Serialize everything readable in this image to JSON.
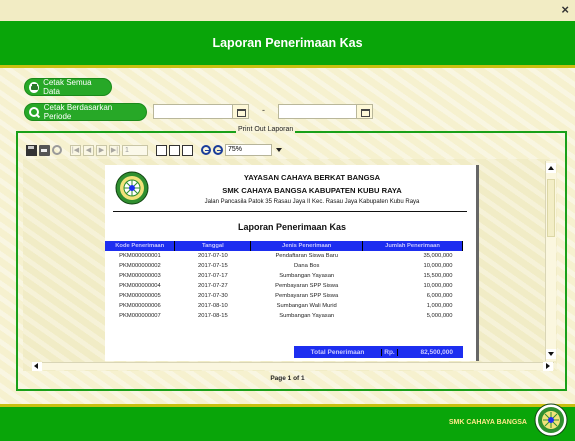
{
  "window": {
    "close_glyph": "×"
  },
  "header": {
    "title": "Laporan Penerimaan Kas"
  },
  "buttons": {
    "print_all": "Cetak Semua Data",
    "print_period": "Cetak Berdasarkan Periode"
  },
  "period": {
    "separator": "-"
  },
  "group": {
    "title": "Print Out Laporan"
  },
  "viewer_toolbar": {
    "prev": "◀",
    "first": "|◀",
    "next": "▶",
    "last": "▶|",
    "page_value": "1",
    "zoom_value": "75%"
  },
  "report": {
    "org_name": "YAYASAN CAHAYA BERKAT BANGSA",
    "school_name": "SMK CAHAYA BANGSA KABUPATEN KUBU RAYA",
    "address": "Jalan Pancasila Patok 35 Rasau Jaya II Kec. Rasau Jaya Kabupaten Kubu Raya",
    "title": "Laporan Penerimaan Kas",
    "columns": [
      "Kode Penerimaan",
      "Tanggal",
      "Jenis Penerimaan",
      "Jumlah Penerimaan"
    ],
    "rows": [
      [
        "PKM000000001",
        "2017-07-10",
        "Pendaftaran Siswa Baru",
        "35,000,000"
      ],
      [
        "PKM000000002",
        "2017-07-15",
        "Dana Bos",
        "10,000,000"
      ],
      [
        "PKM000000003",
        "2017-07-17",
        "Sumbangan Yayasan",
        "15,500,000"
      ],
      [
        "PKM000000004",
        "2017-07-27",
        "Pembayaran SPP Siswa",
        "10,000,000"
      ],
      [
        "PKM000000005",
        "2017-07-30",
        "Pembayaran SPP Siswa",
        "6,000,000"
      ],
      [
        "PKM000000006",
        "2017-08-10",
        "Sumbangan Wali Murid",
        "1,000,000"
      ],
      [
        "PKM000000007",
        "2017-08-15",
        "Sumbangan Yayasan",
        "5,000,000"
      ]
    ],
    "total_label": "Total Penerimaan",
    "total_currency": "Rp.",
    "total_value": "82,500,000"
  },
  "page_info": "Page 1 of 1",
  "footer": {
    "brand": "SMK CAHAYA BANGSA"
  },
  "colors": {
    "primary_green": "#09a509",
    "table_header_blue": "#1d2ef0",
    "accent_yellow": "#c8c010"
  }
}
